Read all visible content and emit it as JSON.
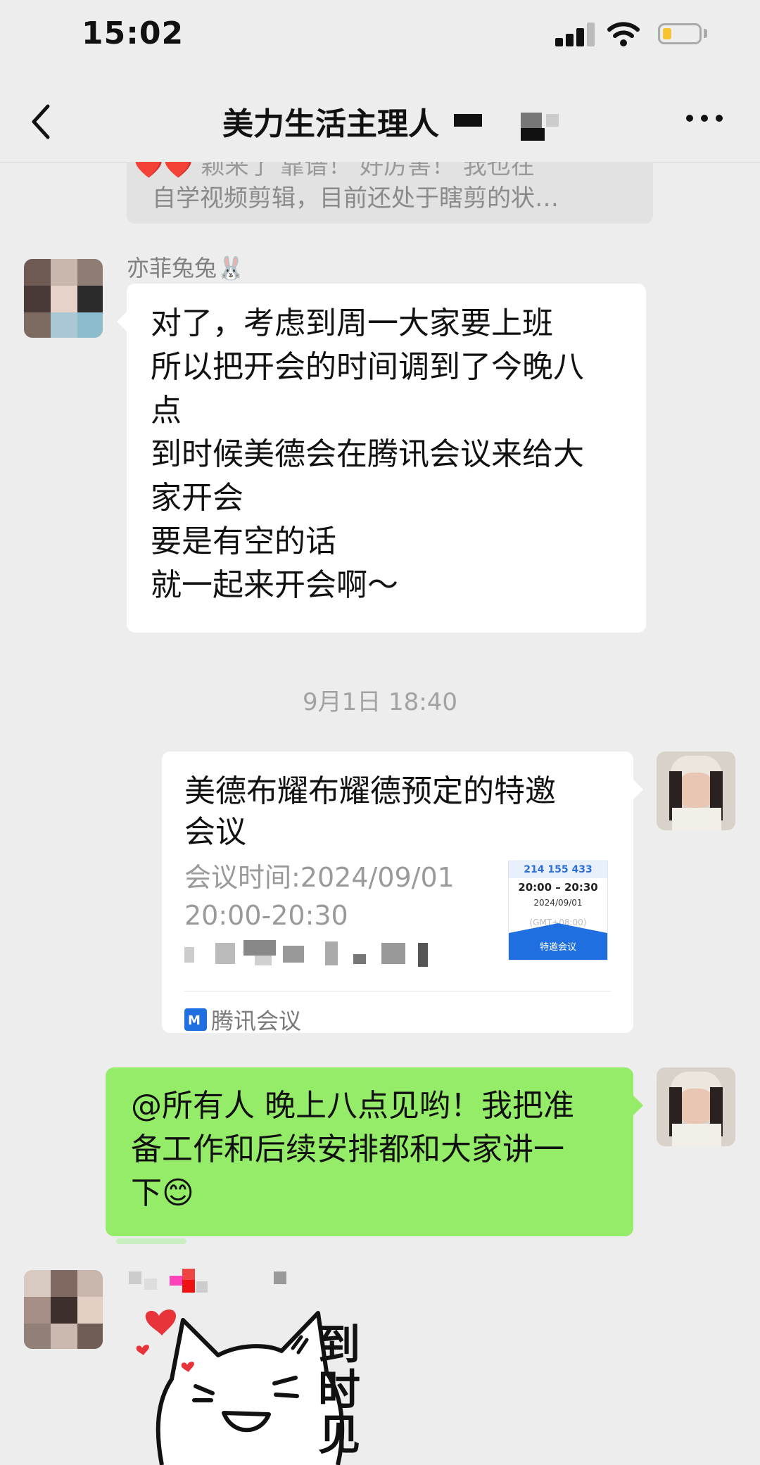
{
  "status_bar": {
    "time": "15:02"
  },
  "nav": {
    "title": "美力生活主理人"
  },
  "quoted": {
    "line1": "❤️❤️  颖来了 靠谱！ 好厉害！ 我也在",
    "line2": "自学视频剪辑，目前还处于瞎剪的状…"
  },
  "messages": {
    "msg1": {
      "sender": "亦菲兔兔🐰",
      "lines": [
        "对了，考虑到周一大家要上班",
        "所以把开会的时间调到了今晚八",
        "点",
        "到时候美德会在腾讯会议来给大",
        "家开会",
        "要是有空的话",
        "就一起来开会啊～"
      ]
    },
    "timestamp": "9月1日 18:40",
    "card": {
      "title_line1": "美德布耀布耀德预定的特邀",
      "title_line2": "会议",
      "time_line1": "会议时间:2024/09/01",
      "time_line2": "20:00-20:30",
      "footer": "腾讯会议",
      "thumb_id": "214 155 433",
      "thumb_time": "20:00 – 20:30",
      "thumb_date": "2024/09/01",
      "thumb_tz": "(GMT+08:00)",
      "thumb_button": "特邀会议"
    },
    "msg3": {
      "lines": [
        "@所有人 晚上八点见哟！我把准",
        "备工作和后续安排都和大家讲一",
        "下😊"
      ]
    },
    "sticker": {
      "text": "到时见"
    }
  },
  "colors": {
    "green_bubble": "#95ec69",
    "background": "#ededed"
  }
}
